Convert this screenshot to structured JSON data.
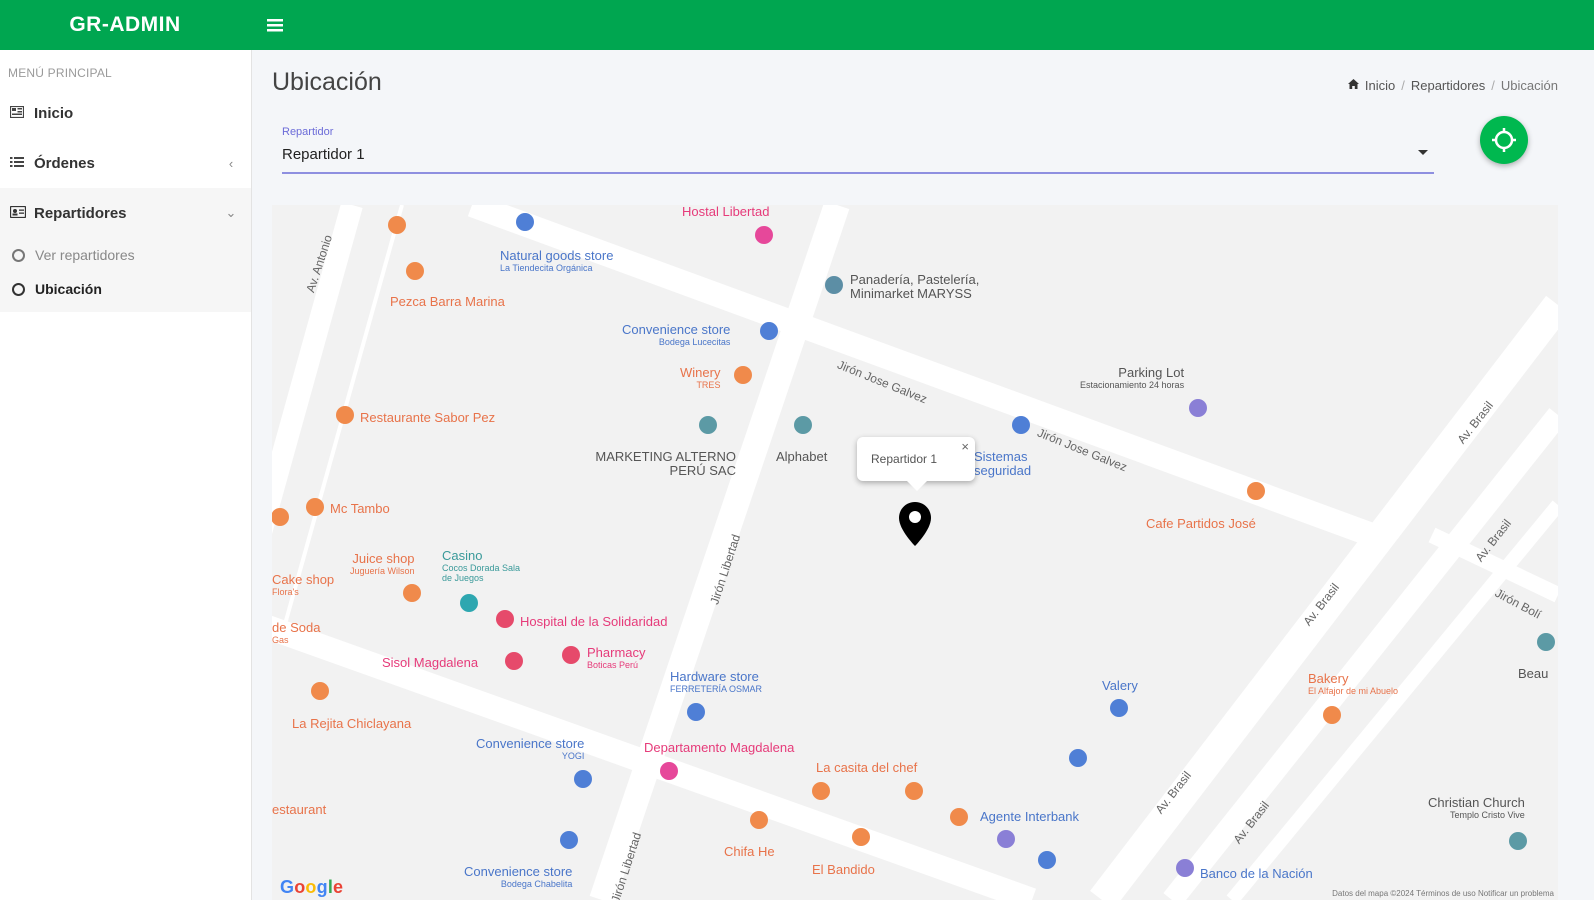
{
  "app": {
    "brand": "GR-ADMIN"
  },
  "sidebar": {
    "header": "MENÚ PRINCIPAL",
    "items": [
      {
        "label": "Inicio",
        "icon": "dashboard-icon"
      },
      {
        "label": "Órdenes",
        "icon": "list-icon"
      },
      {
        "label": "Repartidores",
        "icon": "id-card-icon"
      }
    ],
    "sub_items": [
      {
        "label": "Ver repartidores",
        "active": false
      },
      {
        "label": "Ubicación",
        "active": true
      }
    ]
  },
  "page": {
    "title": "Ubicación",
    "breadcrumb": [
      "Inicio",
      "Repartidores",
      "Ubicación"
    ]
  },
  "repartidor_select": {
    "label": "Repartidor",
    "value": "Repartidor 1"
  },
  "map": {
    "info_window": "Repartidor 1",
    "info_close": "×",
    "google_logo": "Google",
    "footer": "Datos del mapa ©2024   Términos de uso   Notificar un problema",
    "pois": [
      {
        "name": "Hostal Libertad",
        "color": "pink"
      },
      {
        "name": "Natural goods store",
        "sub": "La Tiendecita Orgánica",
        "color": "blue"
      },
      {
        "name": "Panadería, Pastelería, Minimarket MARYSS",
        "color": "gray"
      },
      {
        "name": "Pezca Barra Marina",
        "color": "orange"
      },
      {
        "name": "Convenience store",
        "sub": "Bodega Lucecitas",
        "color": "blue"
      },
      {
        "name": "Winery",
        "sub": "TRES",
        "color": "orange"
      },
      {
        "name": "Parking Lot",
        "sub": "Estacionamiento 24 horas",
        "color": "gray"
      },
      {
        "name": "Restaurante Sabor Pez",
        "color": "orange"
      },
      {
        "name": "MARKETING ALTERNO PERÚ SAC",
        "color": "gray"
      },
      {
        "name": "Alphabet",
        "color": "gray"
      },
      {
        "name": "Sistemas seguridad",
        "color": "blue"
      },
      {
        "name": "Mc Tambo",
        "color": "orange"
      },
      {
        "name": "Cafe Partidos José",
        "color": "orange"
      },
      {
        "name": "Juice shop",
        "sub": "Juguería Wilson",
        "color": "orange"
      },
      {
        "name": "Casino",
        "sub": "Cocos Dorada Sala de Juegos",
        "color": "teal"
      },
      {
        "name": "Cake shop",
        "sub": "Flora's",
        "color": "orange"
      },
      {
        "name": "Hospital de la Solidaridad",
        "color": "pink"
      },
      {
        "name": "de Soda",
        "sub": "Gas",
        "color": "orange"
      },
      {
        "name": "Sisol Magdalena",
        "color": "pink"
      },
      {
        "name": "Pharmacy",
        "sub": "Boticas Perú",
        "color": "pink"
      },
      {
        "name": "Hardware store",
        "sub": "FERRETERÍA OSMAR",
        "color": "blue"
      },
      {
        "name": "Valery",
        "color": "blue"
      },
      {
        "name": "Bakery",
        "sub": "El Alfajor de mi Abuelo",
        "color": "orange"
      },
      {
        "name": "Beau",
        "color": "gray"
      },
      {
        "name": "La Rejita Chiclayana",
        "color": "orange"
      },
      {
        "name": "Convenience store",
        "sub": "YOGI",
        "color": "blue"
      },
      {
        "name": "Departamento Magdalena",
        "color": "pink"
      },
      {
        "name": "La casita del chef",
        "color": "orange"
      },
      {
        "name": "estaurant",
        "color": "orange"
      },
      {
        "name": "Agente Interbank",
        "color": "blue"
      },
      {
        "name": "Christian Church",
        "sub": "Templo Cristo Vive",
        "color": "gray"
      },
      {
        "name": "Chifa He",
        "color": "orange"
      },
      {
        "name": "El Bandido",
        "color": "orange"
      },
      {
        "name": "Convenience store",
        "sub": "Bodega Chabelita",
        "color": "blue"
      },
      {
        "name": "Banco de la Nación",
        "color": "blue"
      }
    ],
    "streets": [
      {
        "name": "Av. Antonio"
      },
      {
        "name": "Jirón Jose Galvez"
      },
      {
        "name": "Jirón Jose Galvez"
      },
      {
        "name": "Jirón Libertad"
      },
      {
        "name": "Jirón Libertad"
      },
      {
        "name": "Av. Brasil"
      },
      {
        "name": "Av. Brasil"
      },
      {
        "name": "Av. Brasil"
      },
      {
        "name": "Av. Brasil"
      },
      {
        "name": "Av. Brasil"
      },
      {
        "name": "Jirón Bolí"
      }
    ]
  }
}
